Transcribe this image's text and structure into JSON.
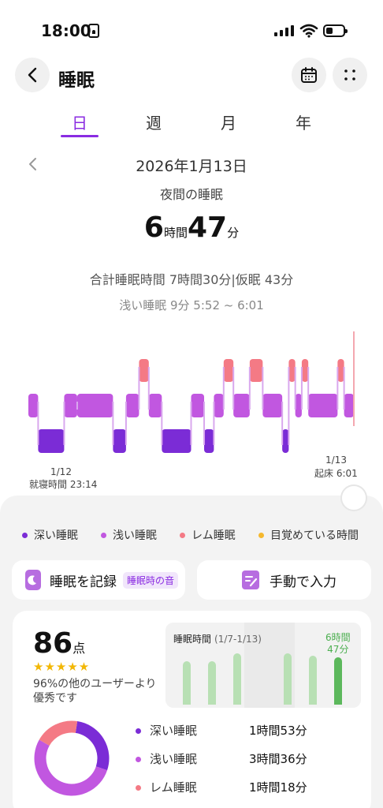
{
  "status_bar": {
    "time": "18:00"
  },
  "header": {
    "title": "睡眠"
  },
  "tabs": [
    {
      "label": "日",
      "active": true
    },
    {
      "label": "週",
      "active": false
    },
    {
      "label": "月",
      "active": false
    },
    {
      "label": "年",
      "active": false
    }
  ],
  "summary": {
    "date": "2026年1月13日",
    "subtitle": "夜間の睡眠",
    "hours": "6",
    "hours_unit": "時間",
    "minutes": "47",
    "minutes_unit": "分",
    "total_text": "合計睡眠時間 7時間30分|仮眠 43分",
    "selected_stage": "浅い睡眠 9分 5:52 ~ 6:01"
  },
  "chart_data": {
    "type": "hypnogram",
    "x_range": [
      "23:14",
      "6:01"
    ],
    "levels": [
      "レム睡眠",
      "浅い睡眠",
      "深い睡眠"
    ],
    "start_label_date": "1/12",
    "start_label": "就寝時間 23:14",
    "end_label_date": "1/13",
    "end_label": "起床 6:01",
    "segments": [
      {
        "stage": "浅い睡眠",
        "from": 0.0,
        "to": 0.03
      },
      {
        "stage": "深い睡眠",
        "from": 0.03,
        "to": 0.11
      },
      {
        "stage": "浅い睡眠",
        "from": 0.11,
        "to": 0.15
      },
      {
        "stage": "浅い睡眠",
        "from": 0.15,
        "to": 0.26
      },
      {
        "stage": "深い睡眠",
        "from": 0.26,
        "to": 0.3
      },
      {
        "stage": "浅い睡眠",
        "from": 0.3,
        "to": 0.34
      },
      {
        "stage": "レム睡眠",
        "from": 0.34,
        "to": 0.37
      },
      {
        "stage": "浅い睡眠",
        "from": 0.37,
        "to": 0.41
      },
      {
        "stage": "深い睡眠",
        "from": 0.41,
        "to": 0.5
      },
      {
        "stage": "浅い睡眠",
        "from": 0.5,
        "to": 0.54
      },
      {
        "stage": "深い睡眠",
        "from": 0.54,
        "to": 0.57
      },
      {
        "stage": "浅い睡眠",
        "from": 0.57,
        "to": 0.6
      },
      {
        "stage": "レム睡眠",
        "from": 0.6,
        "to": 0.63
      },
      {
        "stage": "浅い睡眠",
        "from": 0.63,
        "to": 0.68
      },
      {
        "stage": "レム睡眠",
        "from": 0.68,
        "to": 0.72
      },
      {
        "stage": "浅い睡眠",
        "from": 0.72,
        "to": 0.78
      },
      {
        "stage": "深い睡眠",
        "from": 0.78,
        "to": 0.8
      },
      {
        "stage": "レム睡眠",
        "from": 0.8,
        "to": 0.82
      },
      {
        "stage": "浅い睡眠",
        "from": 0.82,
        "to": 0.84
      },
      {
        "stage": "レム睡眠",
        "from": 0.84,
        "to": 0.86
      },
      {
        "stage": "浅い睡眠",
        "from": 0.86,
        "to": 0.95
      },
      {
        "stage": "レム睡眠",
        "from": 0.95,
        "to": 0.97
      },
      {
        "stage": "浅い睡眠",
        "from": 0.97,
        "to": 1.0
      }
    ],
    "colors": {
      "深い睡眠": "#7b2cd6",
      "浅い睡眠": "#c157e0",
      "レム睡眠": "#f47a85"
    }
  },
  "legend": [
    {
      "label": "深い睡眠",
      "color": "#7b2cd6"
    },
    {
      "label": "浅い睡眠",
      "color": "#c157e0"
    },
    {
      "label": "レム睡眠",
      "color": "#f47a85"
    },
    {
      "label": "目覚めている時間",
      "color": "#f5b82e"
    }
  ],
  "actions": {
    "record_label": "睡眠を記録",
    "record_tag": "睡眠時の音",
    "manual_label": "手動で入力"
  },
  "score": {
    "value": "86",
    "unit": "点",
    "stars": "★★★★★",
    "rating": 4.5,
    "percentile_text": "96%の他のユーザーより優秀です"
  },
  "weekly": {
    "title": "睡眠時間",
    "range": "(1/7-1/13)",
    "last_value_h": "6時間",
    "last_value_m": "47分",
    "bars": [
      0.55,
      0.55,
      0.65,
      0.0,
      0.0,
      0.65,
      0.62,
      0.6
    ]
  },
  "breakdown": [
    {
      "label": "深い睡眠",
      "value": "1時間53分",
      "color": "#7b2cd6"
    },
    {
      "label": "浅い睡眠",
      "value": "3時間36分",
      "color": "#c157e0"
    },
    {
      "label": "レム睡眠",
      "value": "1時間18分",
      "color": "#f47a85"
    }
  ]
}
